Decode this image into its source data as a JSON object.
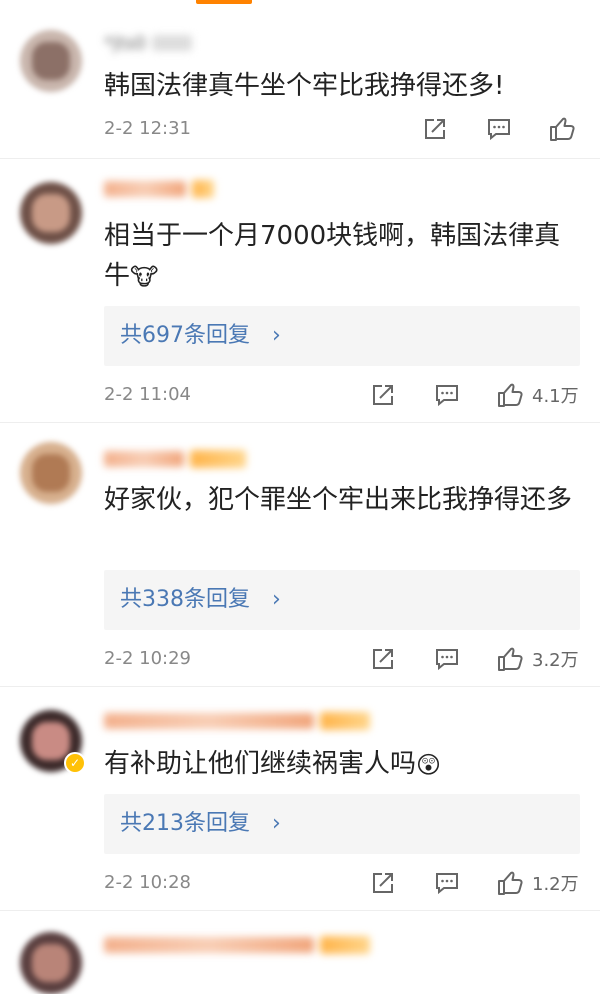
{
  "colors": {
    "accent": "#ff8200",
    "link": "#4a78b4",
    "meta": "#888888"
  },
  "comments": [
    {
      "username": "*jts0",
      "text": "韩国法律真牛坐个牢比我挣得还多!",
      "emoji": "",
      "replies_label": "",
      "time": "2-2 12:31",
      "likes": "",
      "icons": {
        "share": "share-icon",
        "comment": "comment-icon",
        "like": "like-icon"
      }
    },
    {
      "username": "",
      "text": "相当于一个月7000块钱啊，韩国法律真牛",
      "emoji": "🐮",
      "replies_label": "共697条回复",
      "time": "2-2 11:04",
      "likes": "4.1万"
    },
    {
      "username": "",
      "text": "好家伙，犯个罪坐个牢出来比我挣得还多",
      "emoji": "",
      "replies_label": "共338条回复",
      "time": "2-2 10:29",
      "likes": "3.2万"
    },
    {
      "username": "",
      "text": "有补助让他们继续祸害人吗",
      "emoji": "😲",
      "replies_label": "共213条回复",
      "time": "2-2 10:28",
      "likes": "1.2万"
    },
    {
      "username": "",
      "text": "",
      "emoji": "",
      "replies_label": "",
      "time": "",
      "likes": ""
    }
  ]
}
